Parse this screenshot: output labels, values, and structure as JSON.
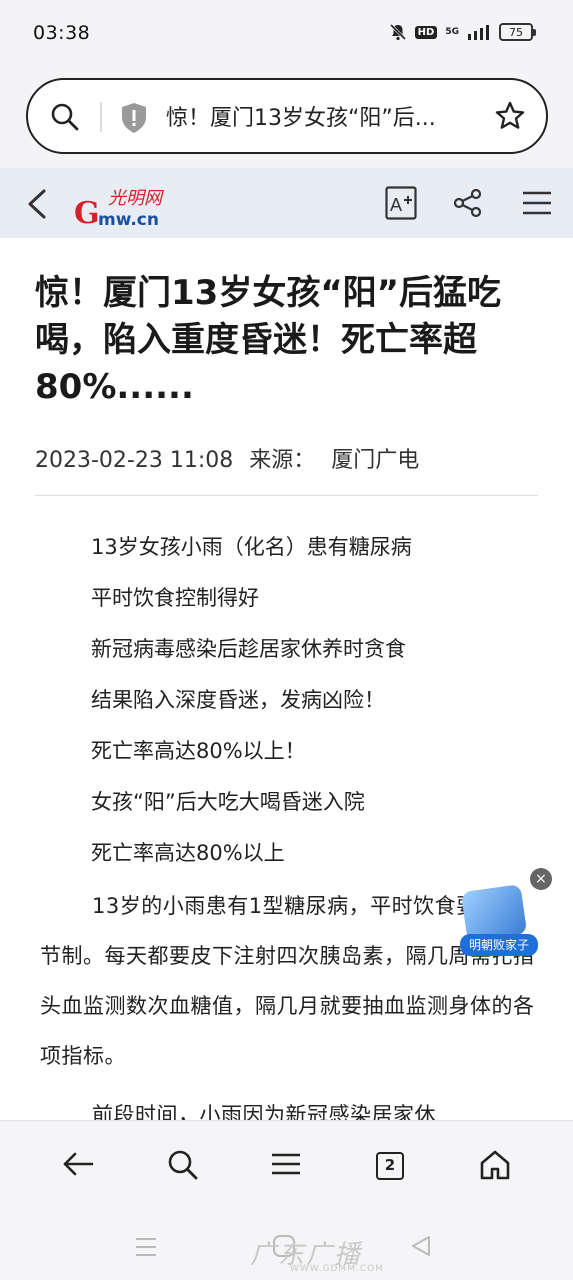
{
  "status_bar": {
    "time": "03:38",
    "hd": "HD",
    "network": "5G",
    "battery": "75"
  },
  "browser": {
    "url_title": "惊！厦门13岁女孩“阳”后..."
  },
  "site": {
    "logo_mark": "光明网",
    "logo_letter": "G",
    "logo_domain": "mw.cn"
  },
  "article": {
    "title": "惊！厦门13岁女孩“阳”后猛吃喝，陷入重度昏迷！死亡率超80%......",
    "date": "2023-02-23 11:08",
    "source_label": "来源：",
    "source": "厦门广电",
    "lines": [
      "13岁女孩小雨（化名）患有糖尿病",
      "平时饮食控制得好",
      "新冠病毒感染后趁居家休养时贪食",
      "结果陷入深度昏迷，发病凶险！",
      "死亡率高达80%以上！",
      "女孩“阳”后大吃大喝昏迷入院",
      "死亡率高达80%以上"
    ],
    "paragraph1": "13岁的小雨患有1型糖尿病，平时饮食要注意节制。每天都要皮下注射四次胰岛素，隔几周需扎指头血监测数次血糖值，隔几月就要抽血监测身体的各项指标。",
    "paragraph2": "前段时间，小雨因为新冠感染居家休"
  },
  "float_ad": {
    "label": "明朝败家子",
    "close": "×"
  },
  "bottom_nav": {
    "tabs_count": "2"
  },
  "watermark": {
    "text": "广东广播",
    "url": "WWW.GDMM.COM"
  }
}
